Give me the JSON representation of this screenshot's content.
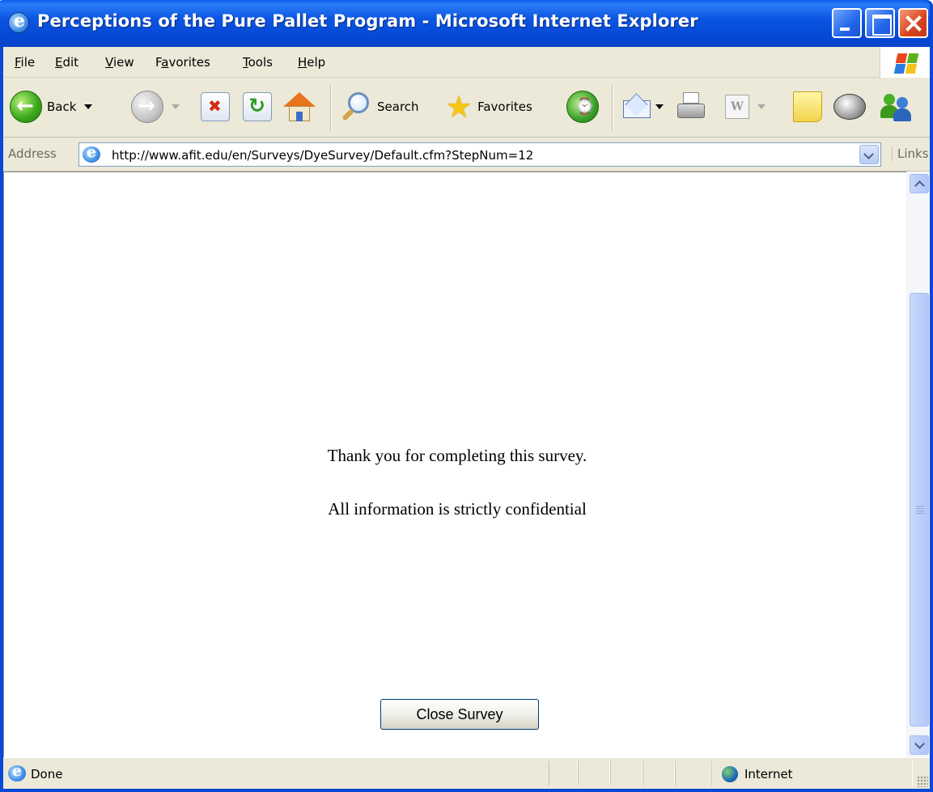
{
  "window": {
    "title": "Perceptions of the Pure Pallet Program - Microsoft Internet Explorer"
  },
  "menu": {
    "items": [
      {
        "label": "File",
        "underline": "F",
        "rest": "ile"
      },
      {
        "label": "Edit",
        "underline": "E",
        "rest": "dit"
      },
      {
        "label": "View",
        "underline": "V",
        "rest": "iew"
      },
      {
        "label": "Favorites",
        "before": "F",
        "underline": "a",
        "rest": "vorites"
      },
      {
        "label": "Tools",
        "underline": "T",
        "rest": "ools"
      },
      {
        "label": "Help",
        "underline": "H",
        "rest": "elp"
      }
    ]
  },
  "toolbar": {
    "back_label": "Back",
    "search_label": "Search",
    "favorites_label": "Favorites"
  },
  "address": {
    "label": "Address",
    "url": "http://www.afit.edu/en/Surveys/DyeSurvey/Default.cfm?StepNum=12",
    "links_label": "Links"
  },
  "content": {
    "thank_you": "Thank you for completing this survey.",
    "confidential": "All information is strictly confidential",
    "close_button": "Close Survey"
  },
  "status": {
    "text": "Done",
    "zone": "Internet"
  },
  "colors": {
    "titlebar": "#0a5ef0",
    "chrome": "#ece9d8",
    "close_button": "#d9421c"
  }
}
